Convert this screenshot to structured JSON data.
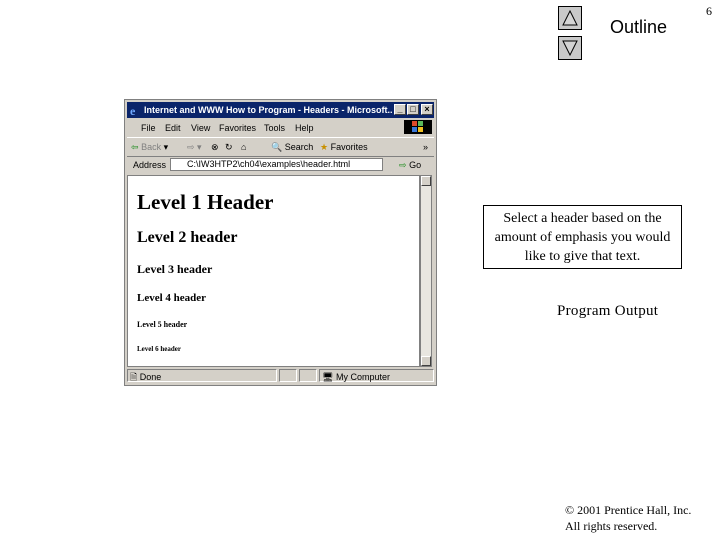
{
  "slide": {
    "number": "6",
    "outline_label": "Outline",
    "nav_up_icon": "triangle-up-icon",
    "nav_down_icon": "triangle-down-icon"
  },
  "browser": {
    "title": "Internet and WWW How to Program - Headers - Microsoft...",
    "menu": [
      "File",
      "Edit",
      "View",
      "Favorites",
      "Tools",
      "Help"
    ],
    "toolbar": {
      "back": "Back",
      "search": "Search",
      "favorites": "Favorites",
      "more": "»"
    },
    "address": {
      "label": "Address",
      "value": "C:\\IW3HTP2\\ch04\\examples\\header.html",
      "go": "Go"
    },
    "headers": [
      "Level 1 Header",
      "Level 2 header",
      "Level 3 header",
      "Level 4 header",
      "Level 5 header",
      "Level 6 header"
    ],
    "status": {
      "text": "Done",
      "zone": "My Computer"
    }
  },
  "callout": "Select a header based on the amount of emphasis you would like to give that text.",
  "program_output": "Program Output",
  "copyright": {
    "line1": "© 2001 Prentice Hall, Inc.",
    "line2": "All rights reserved."
  }
}
